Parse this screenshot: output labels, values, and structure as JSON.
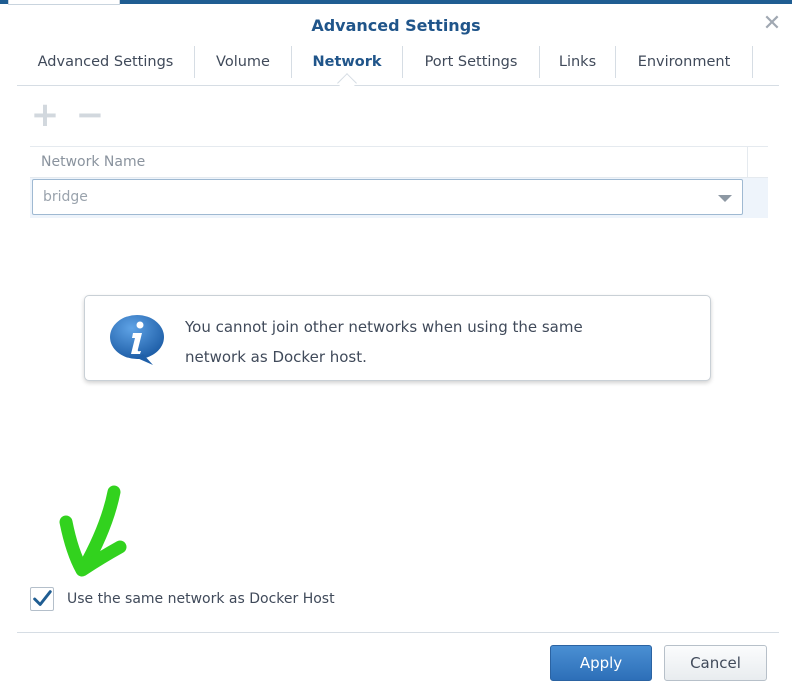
{
  "window": {
    "title": "Advanced Settings"
  },
  "tabs": [
    {
      "label": "Advanced Settings"
    },
    {
      "label": "Volume"
    },
    {
      "label": "Network"
    },
    {
      "label": "Port Settings"
    },
    {
      "label": "Links"
    },
    {
      "label": "Environment"
    }
  ],
  "active_tab": "Network",
  "toolbar": {
    "add_label": "+",
    "remove_label": "−"
  },
  "grid": {
    "header": "Network Name",
    "selected_network": "bridge"
  },
  "info": {
    "message_line1": "You cannot join other networks when using the same",
    "message_line2": "network as Docker host."
  },
  "checkbox": {
    "label": "Use the same network as Docker Host",
    "checked": true
  },
  "buttons": {
    "apply": "Apply",
    "cancel": "Cancel"
  },
  "colors": {
    "accent": "#20558a",
    "apply_bg": "#2d6fb8",
    "annotation_arrow": "#32d21e",
    "checkmark": "#1f5d92"
  }
}
